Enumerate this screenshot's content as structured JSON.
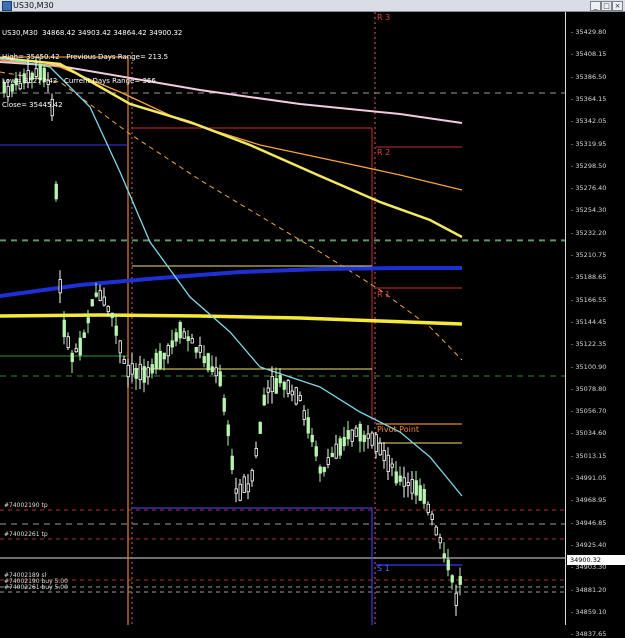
{
  "window": {
    "title": "US30,M30",
    "buttons": [
      "_",
      "□",
      "×"
    ],
    "icon": "chart-window-icon"
  },
  "info": {
    "ohlc": "US30,M30  34868.42 34903.42 34864.42 34900.32",
    "high_line": "High= 35450.42   Previous Days Range= 213.5",
    "low_line": "Low= 35277.42   Current Days Range= 366",
    "close_line": "Close= 35445.42"
  },
  "price_axis": {
    "labels": [
      "35429.80",
      "35408.15",
      "35386.50",
      "35364.15",
      "35342.05",
      "35319.95",
      "35298.50",
      "35276.40",
      "35254.30",
      "35232.20",
      "35210.75",
      "35188.65",
      "35166.55",
      "35144.45",
      "35122.35",
      "35100.90",
      "35078.80",
      "35056.70",
      "35034.60",
      "35013.15",
      "34991.05",
      "34968.95",
      "34946.85",
      "34925.40",
      "34903.30",
      "34881.20",
      "34859.10",
      "34837.65"
    ],
    "current_price": "34900.32"
  },
  "levels": {
    "r3": "R 3",
    "r2": "R 2",
    "r1": "R 1",
    "pivot": "Pivot Point",
    "s1": "S 1"
  },
  "trades": {
    "tp1": "#74002190 tp",
    "tp2": "#74002261 tp",
    "sl": "#74002189 sl",
    "sl2": "#74002190 buy 5.00",
    "buy2": "#74002261 buy 5.00"
  },
  "colors": {
    "background": "#000000",
    "bull": "#b8f5b0",
    "bear": "#ffffff",
    "ma_yellow": "#f2e95e",
    "ma_orange": "#f4a43c",
    "ma_pink": "#f5c9df",
    "ma_blue": "#1f2fd6",
    "ma_cyan": "#7fd6e8",
    "pivot": "#e28a2b",
    "resistance": "#c7302f",
    "grid_green": "#2c8a3a"
  }
}
